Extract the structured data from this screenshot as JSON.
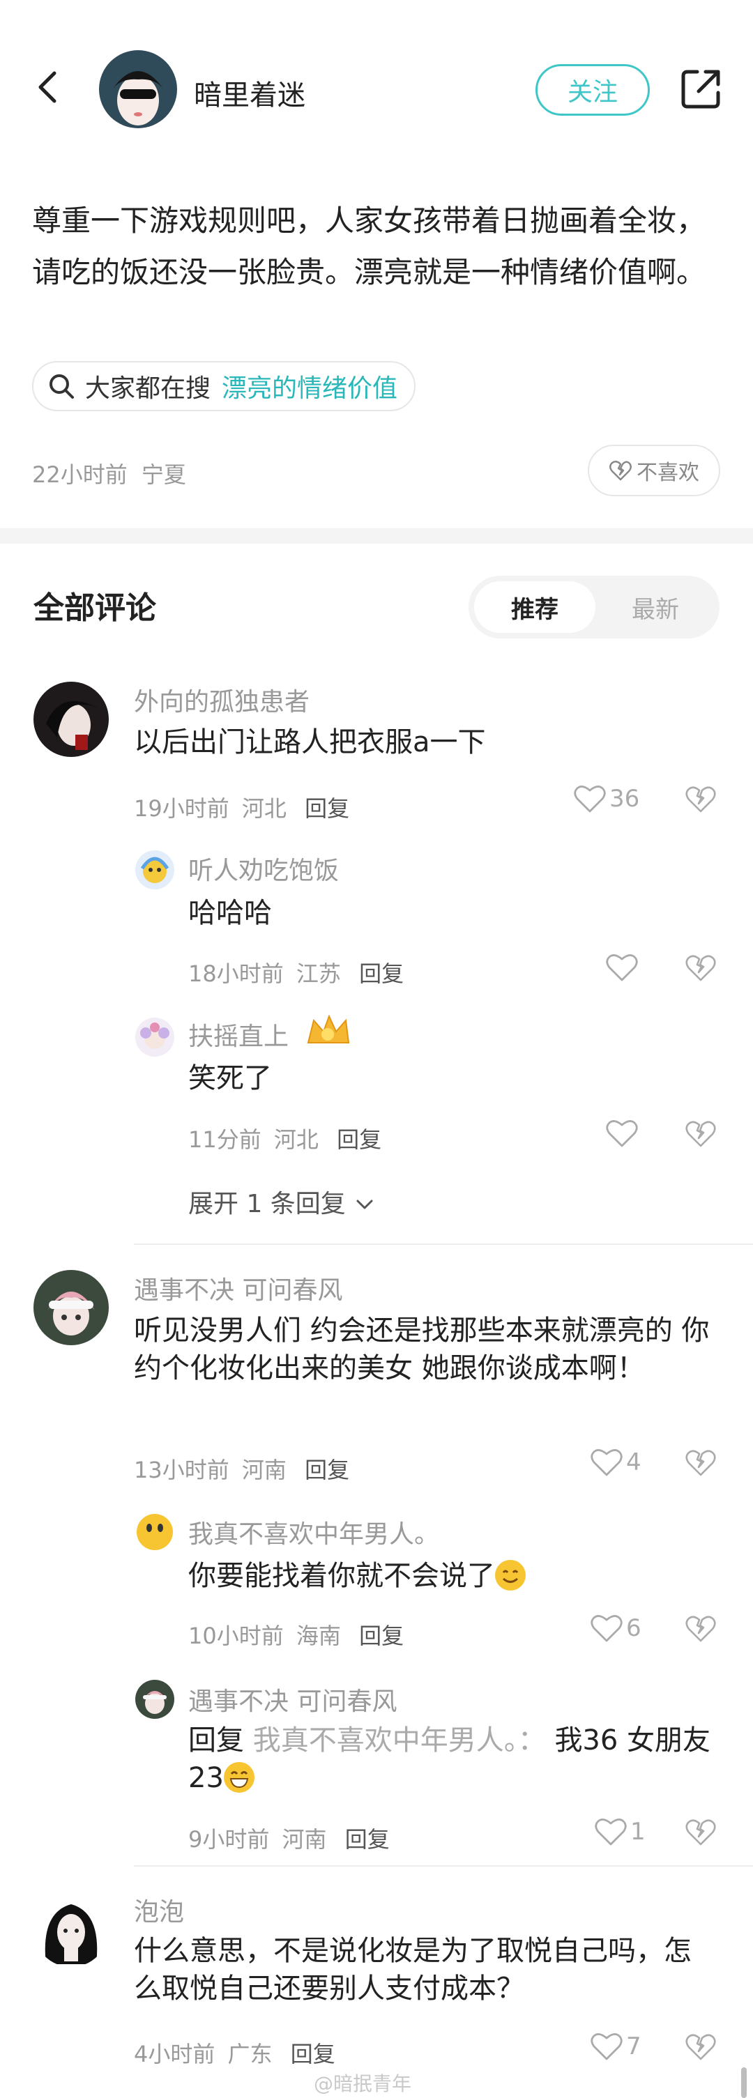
{
  "header": {
    "author_name": "暗里着迷",
    "follow_label": "关注"
  },
  "post": {
    "text": "尊重一下游戏规则吧，人家女孩带着日抛画着全妆，请吃的饭还没一张脸贵。漂亮就是一种情绪价值啊。",
    "search_prefix": "大家都在搜",
    "search_topic": "漂亮的情绪价值",
    "time": "22小时前",
    "location": "宁夏",
    "dislike_label": "不喜欢"
  },
  "comments_section": {
    "title": "全部评论",
    "sort_recommended": "推荐",
    "sort_latest": "最新"
  },
  "comments": [
    {
      "user": "外向的孤独患者",
      "text": "以后出门让路人把衣服a一下",
      "time": "19小时前",
      "location": "河北",
      "reply_label": "回复",
      "likes": "36",
      "replies": [
        {
          "user": "听人劝吃饱饭",
          "text": "哈哈哈",
          "time": "18小时前",
          "location": "江苏",
          "reply_label": "回复"
        },
        {
          "user": "扶摇直上",
          "text": "笑死了",
          "time": "11分前",
          "location": "河北",
          "reply_label": "回复"
        }
      ],
      "expand_label": "展开 1 条回复"
    },
    {
      "user": "遇事不决 可问春风",
      "text": "听见没男人们 约会还是找那些本来就漂亮的 你约个化妆化出来的美女 她跟你谈成本啊！",
      "time": "13小时前",
      "location": "河南",
      "reply_label": "回复",
      "likes": "4",
      "replies": [
        {
          "user": "我真不喜欢中年男人。",
          "text": "你要能找着你就不会说了",
          "time": "10小时前",
          "location": "海南",
          "reply_label": "回复",
          "likes": "6"
        },
        {
          "user": "遇事不决 可问春风",
          "reply_prefix": "回复",
          "reply_to": "我真不喜欢中年男人。：",
          "text": "我36 女朋友23",
          "time": "9小时前",
          "location": "河南",
          "reply_label": "回复",
          "likes": "1"
        }
      ]
    },
    {
      "user": "泡泡",
      "text": "什么意思，不是说化妆是为了取悦自己吗，怎么取悦自己还要别人支付成本？",
      "time": "4小时前",
      "location": "广东",
      "reply_label": "回复",
      "likes": "7"
    }
  ],
  "watermark": "@暗抿青年",
  "colors": {
    "accent": "#3fc6c8",
    "topic": "#2ab7b9",
    "muted": "#999999"
  }
}
